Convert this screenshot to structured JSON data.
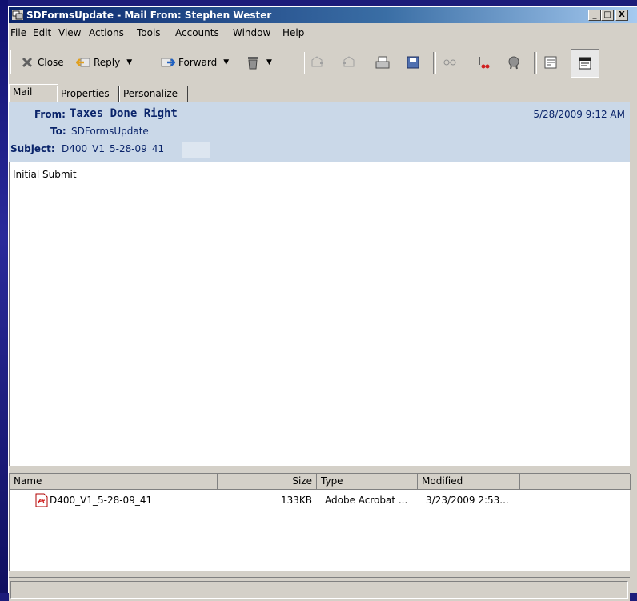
{
  "window": {
    "title": "SDFormsUpdate - Mail From: Stephen Wester",
    "buttons": {
      "minimize": "_",
      "maximize": "□",
      "close": "X"
    }
  },
  "menu": [
    "File",
    "Edit",
    "View",
    "Actions",
    "Tools",
    "Accounts",
    "Window",
    "Help"
  ],
  "toolbar": {
    "close_label": "Close",
    "reply_label": "Reply",
    "forward_label": "Forward",
    "icons": [
      "close-icon",
      "reply-icon",
      "forward-icon",
      "trash-icon",
      "prev-message-icon",
      "next-message-icon",
      "print-icon",
      "save-icon",
      "read-receipt-icon",
      "spell-icon",
      "security-icon",
      "header-view-icon",
      "full-view-icon"
    ]
  },
  "tabs": [
    "Mail",
    "Properties",
    "Personalize"
  ],
  "header": {
    "from_label": "From:",
    "from_value": "Taxes Done Right",
    "to_label": "To:",
    "to_value": "SDFormsUpdate",
    "subject_label": "Subject:",
    "subject_value": "D400_V1_5-28-09_41",
    "date": "5/28/2009 9:12 AM"
  },
  "body": {
    "text": "Initial Submit"
  },
  "attachments": {
    "columns": [
      "Name",
      "Size",
      "Type",
      "Modified"
    ],
    "rows": [
      {
        "name": "D400_V1_5-28-09_41",
        "size": "133KB",
        "type": "Adobe Acrobat ...",
        "modified": "3/23/2009 2:53..."
      }
    ]
  },
  "colors": {
    "title_bar": "#0a246a",
    "header_panel": "#cad8e8",
    "chrome": "#d4d0c8"
  }
}
